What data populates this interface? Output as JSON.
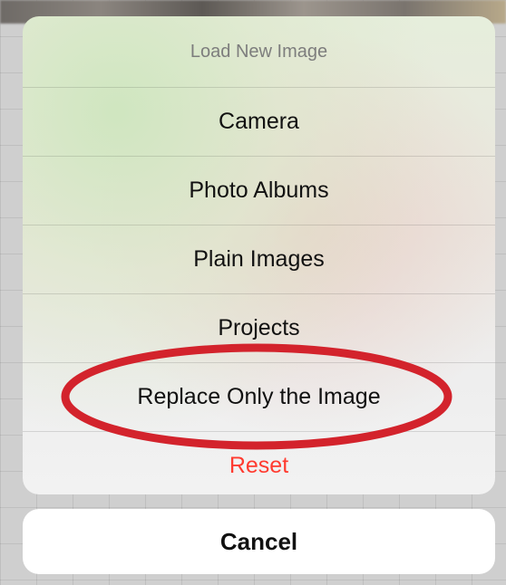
{
  "action_sheet": {
    "title": "Load New Image",
    "items": [
      {
        "label": "Camera",
        "style": "default"
      },
      {
        "label": "Photo Albums",
        "style": "default"
      },
      {
        "label": "Plain Images",
        "style": "default"
      },
      {
        "label": "Projects",
        "style": "default"
      },
      {
        "label": "Replace Only the Image",
        "style": "default"
      },
      {
        "label": "Reset",
        "style": "destructive"
      }
    ],
    "cancel_label": "Cancel"
  },
  "annotation": {
    "shape": "ellipse",
    "color": "#d3232c",
    "highlights": "Replace Only the Image"
  },
  "colors": {
    "destructive": "#ff3b30",
    "title_text": "#7d7d7d"
  }
}
